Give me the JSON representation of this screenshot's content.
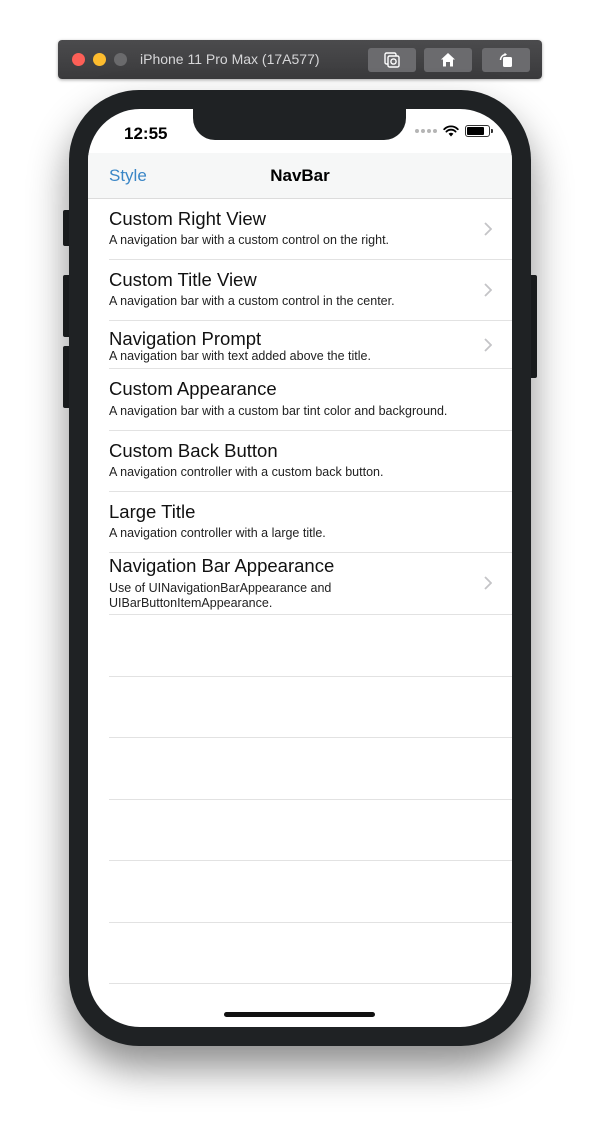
{
  "simulator": {
    "title": "iPhone 11 Pro Max (17A577)",
    "buttons": [
      "screenshot-icon",
      "home-icon",
      "rotate-icon"
    ]
  },
  "status_bar": {
    "time": "12:55"
  },
  "nav_bar": {
    "back_label": "Style",
    "title": "NavBar"
  },
  "rows": [
    {
      "title": "Custom Right View",
      "subtitle": "A navigation bar with a custom control on the right.",
      "chevron": true
    },
    {
      "title": "Custom Title View",
      "subtitle": "A navigation bar with a custom control in the center.",
      "chevron": true
    },
    {
      "title": "Navigation Prompt",
      "subtitle": "A navigation bar with text added above the title.",
      "chevron": true
    },
    {
      "title": "Custom Appearance",
      "subtitle": "A navigation bar with a custom bar tint color and background.",
      "chevron": false
    },
    {
      "title": "Custom Back Button",
      "subtitle": "A navigation controller with a custom back button.",
      "chevron": false
    },
    {
      "title": "Large Title",
      "subtitle": "A navigation controller with a large title.",
      "chevron": false
    },
    {
      "title": "Navigation Bar Appearance",
      "subtitle": "Use of UINavigationBarAppearance and UIBarButtonItemAppearance.",
      "chevron": true
    }
  ],
  "colors": {
    "tint": "#3a86c6",
    "navbar_bg": "#f6f7f7",
    "separator": "#e2e2e2",
    "chevron": "#c4c4c7"
  }
}
